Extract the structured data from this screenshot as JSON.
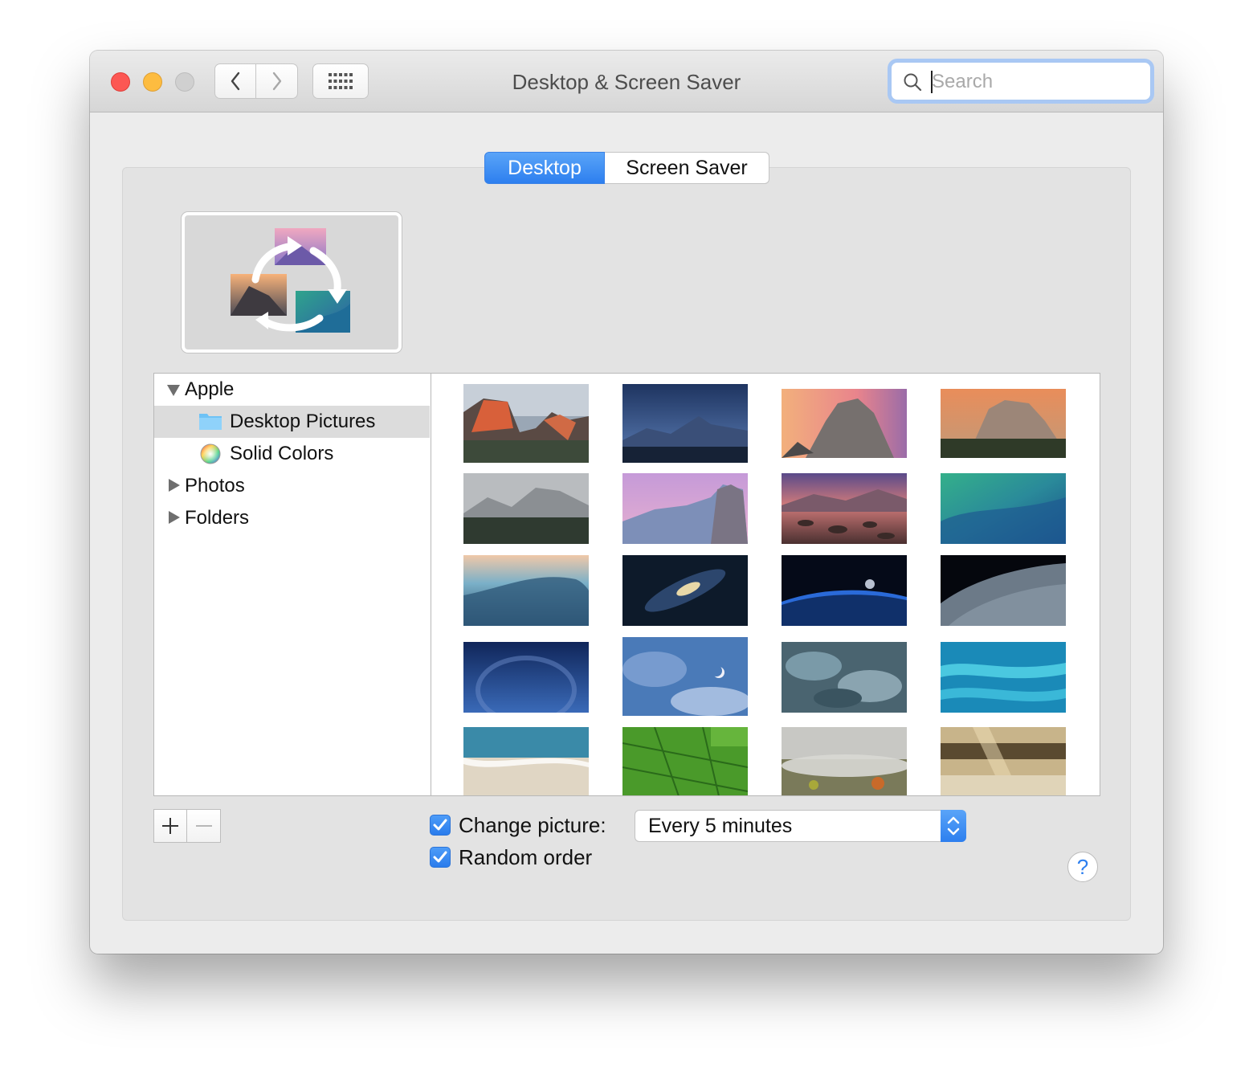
{
  "window": {
    "title": "Desktop & Screen Saver"
  },
  "toolbar": {
    "back_icon": "chevron-left-icon",
    "forward_icon": "chevron-right-icon",
    "show_all_icon": "grid-icon"
  },
  "search": {
    "placeholder": "Search",
    "value": ""
  },
  "tabs": [
    {
      "label": "Desktop",
      "selected": true
    },
    {
      "label": "Screen Saver",
      "selected": false
    }
  ],
  "sources": [
    {
      "label": "Apple",
      "level": 0,
      "expanded": true
    },
    {
      "label": "Desktop Pictures",
      "level": 1,
      "icon": "folder-icon",
      "selected": true
    },
    {
      "label": "Solid Colors",
      "level": 1,
      "icon": "color-wheel-icon"
    },
    {
      "label": "Photos",
      "level": 0,
      "expanded": false
    },
    {
      "label": "Folders",
      "level": 0,
      "expanded": false
    }
  ],
  "options": {
    "change_picture_label": "Change picture:",
    "change_picture_checked": true,
    "interval": "Every 5 minutes",
    "random_order_label": "Random order",
    "random_order_checked": true
  },
  "buttons": {
    "add": "+",
    "remove": "—",
    "help": "?"
  },
  "colors": {
    "accent": "#3a8cf5",
    "window_bg": "#ececec",
    "panel_bg": "#e3e3e3"
  }
}
